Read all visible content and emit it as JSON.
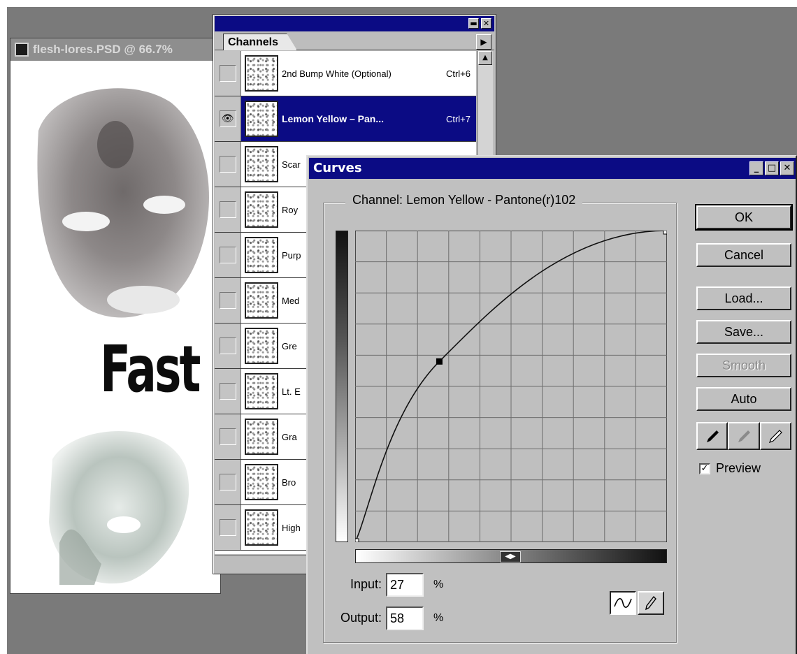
{
  "document": {
    "title": "flesh-lores.PSD @ 66.7%",
    "headline_text": "Fast"
  },
  "channels_palette": {
    "tab_label": "Channels",
    "minimize_glyph": "▬",
    "close_glyph": "✕",
    "menu_arrow_glyph": "▶",
    "scroll_up_glyph": "▲",
    "eye_glyph": "👁",
    "rows": [
      {
        "name": "2nd Bump White (Optional)",
        "shortcut": "Ctrl+6",
        "visible": false,
        "selected": false
      },
      {
        "name": "Lemon Yellow – Pan...",
        "shortcut": "Ctrl+7",
        "visible": true,
        "selected": true
      },
      {
        "name": "Scar",
        "shortcut": "",
        "visible": false,
        "selected": false
      },
      {
        "name": "Roy",
        "shortcut": "",
        "visible": false,
        "selected": false
      },
      {
        "name": "Purp",
        "shortcut": "",
        "visible": false,
        "selected": false
      },
      {
        "name": "Med",
        "shortcut": "",
        "visible": false,
        "selected": false
      },
      {
        "name": "Gre",
        "shortcut": "",
        "visible": false,
        "selected": false
      },
      {
        "name": "Lt. E",
        "shortcut": "",
        "visible": false,
        "selected": false
      },
      {
        "name": "Gra",
        "shortcut": "",
        "visible": false,
        "selected": false
      },
      {
        "name": "Bro",
        "shortcut": "",
        "visible": false,
        "selected": false
      },
      {
        "name": "High",
        "shortcut": "",
        "visible": false,
        "selected": false
      }
    ]
  },
  "curves_dialog": {
    "title": "Curves",
    "minimize_glyph": "_",
    "maximize_glyph": "□",
    "close_glyph": "✕",
    "channel_label": "Channel:",
    "channel_value": "Lemon Yellow - Pantone(r)102",
    "input_label": "Input:",
    "input_value": "27",
    "output_label": "Output:",
    "output_value": "58",
    "percent_sign": "%",
    "buttons": {
      "ok": "OK",
      "cancel": "Cancel",
      "load": "Load...",
      "save": "Save...",
      "smooth": "Smooth",
      "auto": "Auto"
    },
    "preview_label": "Preview",
    "preview_checked": true,
    "checkmark_glyph": "✓",
    "gradient_toggle_glyph": "◀▶",
    "curve_points": [
      {
        "input": 0,
        "output": 0
      },
      {
        "input": 27,
        "output": 58
      },
      {
        "input": 100,
        "output": 100
      }
    ],
    "grid_divisions": 10
  }
}
